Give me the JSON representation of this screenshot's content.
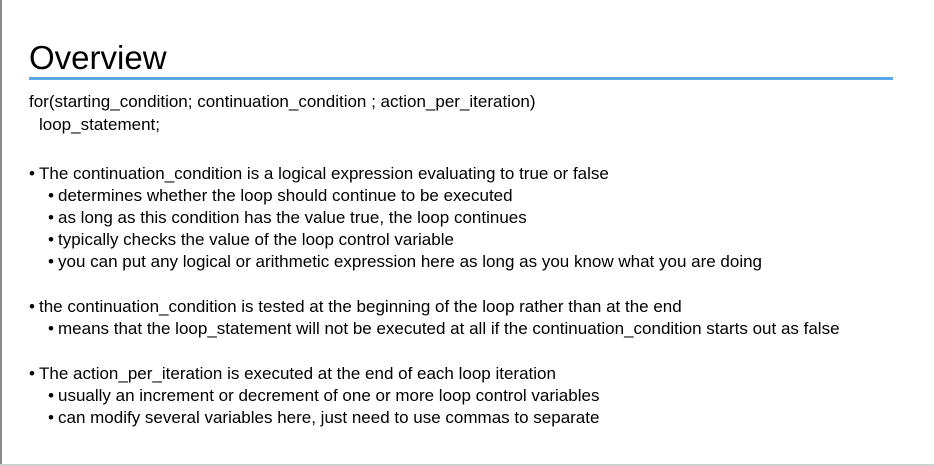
{
  "slide": {
    "title": "Overview",
    "code": {
      "line1": "for(starting_condition; continuation_condition ; action_per_iteration)",
      "line2": "loop_statement;"
    },
    "groups": [
      {
        "bullet": "The continuation_condition is a logical expression evaluating to true or false",
        "subs": [
          "determines whether the loop should continue to be executed",
          "as long as this condition has the value true, the loop continues",
          "typically checks the value of the loop control variable",
          "you can put any logical or arithmetic expression here as long as you know what you are doing"
        ]
      },
      {
        "bullet": "the continuation_condition is tested at the beginning of the loop rather than at the end",
        "subs": [
          "means that the loop_statement will not be executed at all if the continuation_condition starts out as false"
        ]
      },
      {
        "bullet": "The action_per_iteration is executed at the end of each loop iteration",
        "subs": [
          "usually an increment or decrement of one or more loop control variables",
          "can modify several variables here, just need to use commas to separate"
        ]
      }
    ]
  }
}
